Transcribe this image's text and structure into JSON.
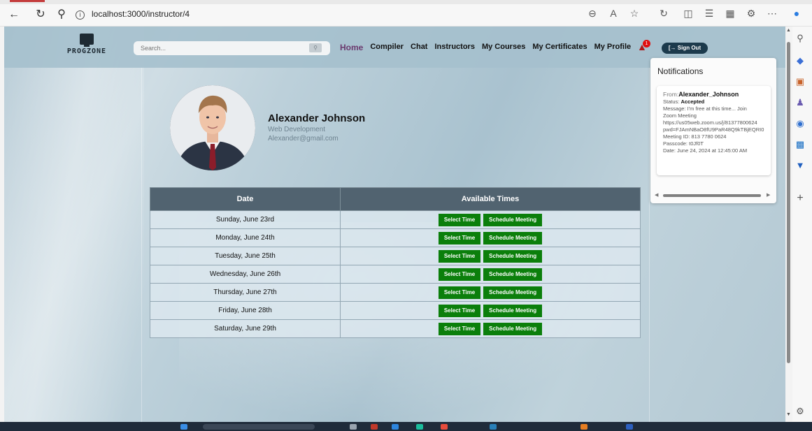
{
  "browser": {
    "url": "localhost:3000/instructor/4",
    "info_icon": "i"
  },
  "nav": {
    "logo_text": "PROGZONE",
    "search_placeholder": "Search...",
    "links": [
      "Home",
      "Compiler",
      "Chat",
      "Instructors",
      "My Courses",
      "My Certificates",
      "My Profile"
    ],
    "notification_count": "1",
    "sign_out": "[→ Sign Out"
  },
  "profile": {
    "name": "Alexander Johnson",
    "specialty": "Web Development",
    "email": "Alexander@gmail.com"
  },
  "schedule": {
    "headers": [
      "Date",
      "Available Times"
    ],
    "select_label": "Select Time",
    "schedule_label": "Schedule Meeting",
    "rows": [
      "Sunday, June 23rd",
      "Monday, June 24th",
      "Tuesday, June 25th",
      "Wednesday, June 26th",
      "Thursday, June 27th",
      "Friday, June 28th",
      "Saturday, June 29th"
    ]
  },
  "notifications": {
    "title": "Notifications",
    "items": [
      {
        "from_label": "From:",
        "from": "Alexander_Johnson",
        "status_label": "Status:",
        "status": "Accepted",
        "message": "Message: I'm free at this time... Join",
        "lines": [
          "Zoom Meeting",
          "https://us05web.zoom.us/j/81377800624",
          "pwd=FJAmNBaO8fU9PaR48Q9kTBjEQRI0",
          "Meeting ID: 813 7780 0624",
          "Passcode: t0Jf0T",
          "Date: June 24, 2024 at 12:45:00 AM"
        ]
      }
    ]
  },
  "colors": {
    "accent_green": "#0b7f0b",
    "header_dark": "#516370",
    "home_link": "#6b3a6e",
    "sign_out_bg": "#1c3a4c",
    "badge_red": "#e01010"
  }
}
